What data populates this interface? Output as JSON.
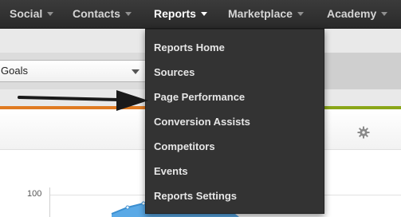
{
  "nav": {
    "items": [
      {
        "label": "Social"
      },
      {
        "label": "Contacts"
      },
      {
        "label": "Reports"
      },
      {
        "label": "Marketplace"
      },
      {
        "label": "Academy"
      }
    ],
    "active": "Reports"
  },
  "filters": {
    "goal_select_value": "Goals"
  },
  "chart": {
    "y_tick": "100"
  },
  "dropdown": {
    "items": [
      {
        "label": "Reports Home"
      },
      {
        "label": "Sources"
      },
      {
        "label": "Page Performance"
      },
      {
        "label": "Conversion Assists"
      },
      {
        "label": "Competitors"
      },
      {
        "label": "Events"
      },
      {
        "label": "Reports Settings"
      }
    ]
  },
  "colors": {
    "nav_bg": "#333333",
    "accent_orange": "#e07b22",
    "accent_green": "#8aa619",
    "chart_blue": "#5aa9e6"
  },
  "icons": [
    "caret-down-icon",
    "gear-icon",
    "arrow-annotation"
  ]
}
